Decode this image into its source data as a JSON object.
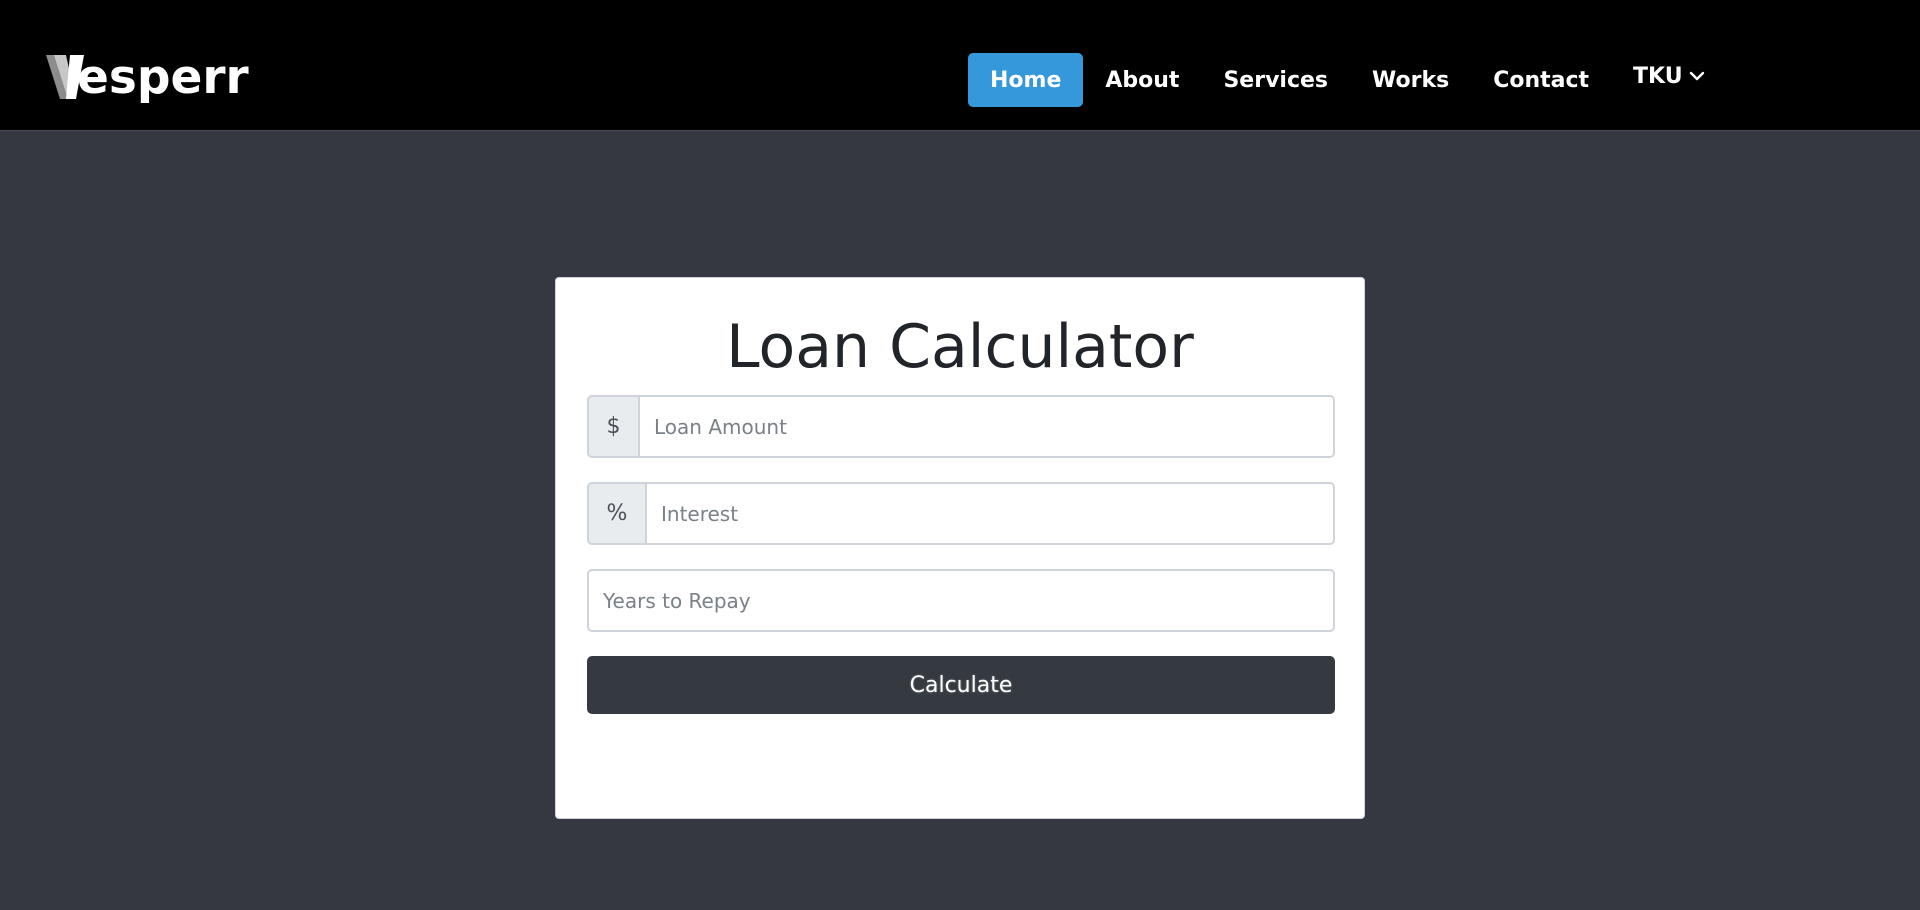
{
  "brand": {
    "name": "Vesperr",
    "text_tail": "esperr"
  },
  "nav": {
    "items": [
      {
        "label": "Home",
        "active": true
      },
      {
        "label": "About",
        "active": false
      },
      {
        "label": "Services",
        "active": false
      },
      {
        "label": "Works",
        "active": false
      },
      {
        "label": "Contact",
        "active": false
      }
    ],
    "dropdown_label": "TKU",
    "dropdown_icon": "chevron-down-icon"
  },
  "calculator": {
    "title": "Loan Calculator",
    "amount_prefix": "$",
    "amount_placeholder": "Loan Amount",
    "interest_prefix": "%",
    "interest_placeholder": "Interest",
    "years_placeholder": "Years to Repay",
    "calculate_label": "Calculate"
  },
  "colors": {
    "page_background": "#353840",
    "navbar_background": "#000000",
    "active_nav": "#3498db",
    "button_background": "#343a40",
    "card_background": "#ffffff"
  }
}
